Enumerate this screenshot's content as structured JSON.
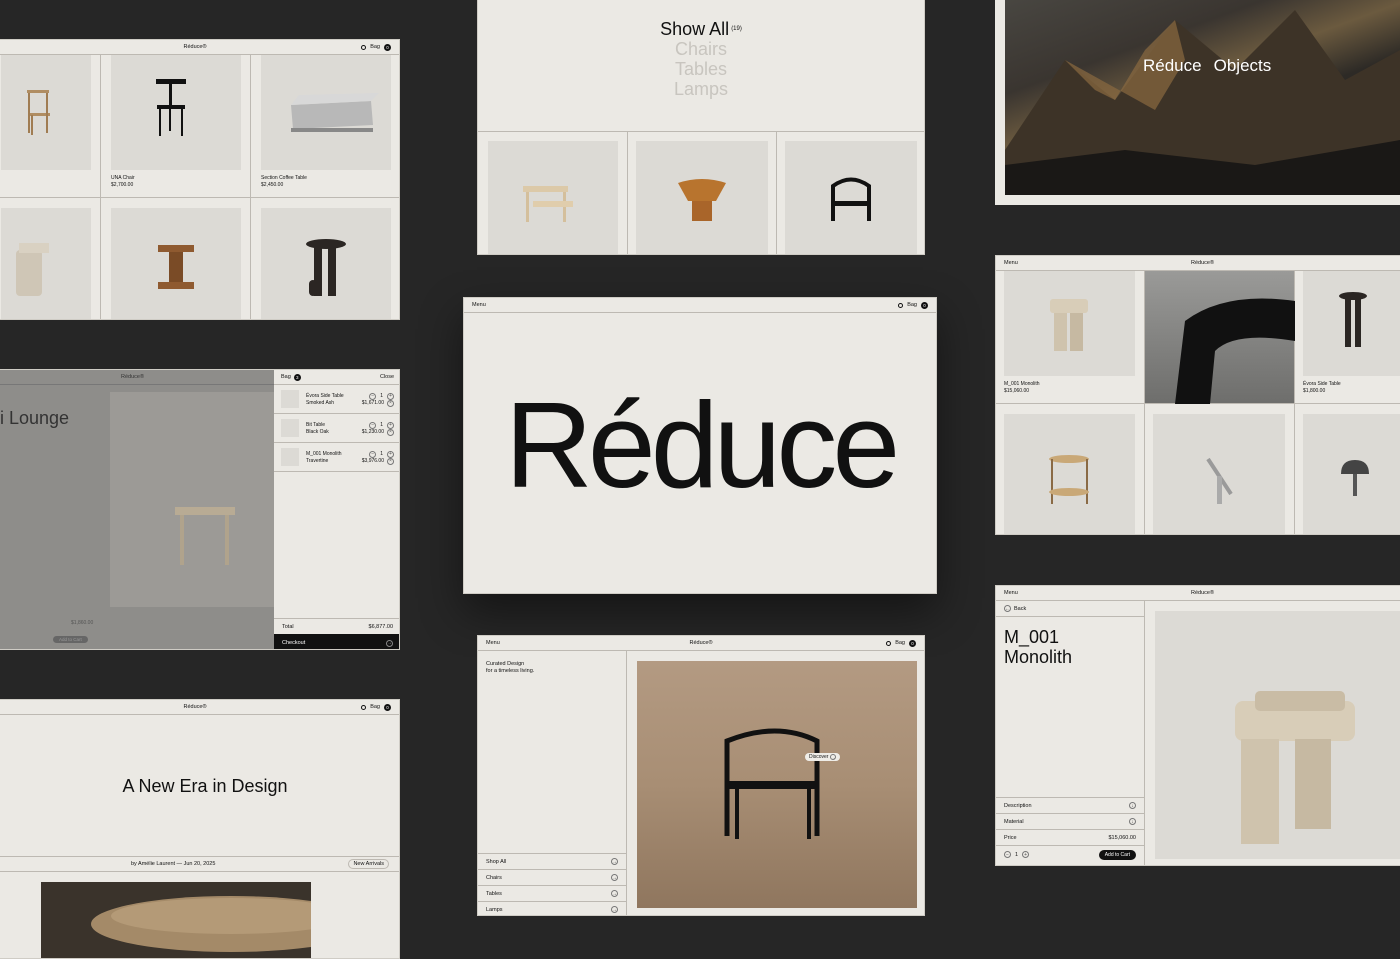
{
  "brand": "Réduce®",
  "common": {
    "menu": "Menu",
    "bag": "Bag",
    "bag_count": "0",
    "bag_count_filled": "3"
  },
  "grid_topleft": {
    "items": [
      {
        "name": "UNA Chair",
        "price": "$2,700.00"
      },
      {
        "name": "Section Coffee Table",
        "price": "$2,450.00"
      }
    ]
  },
  "show_all": {
    "title": "Show All",
    "count": "(19)",
    "filters": [
      "Chairs",
      "Tables",
      "Lamps"
    ]
  },
  "hero_mountain": {
    "links": [
      "Réduce",
      "Objects"
    ]
  },
  "bag_panel": {
    "bg_title": "ci Lounge\nr",
    "bag_label": "Bag",
    "close": "Close",
    "items": [
      {
        "name": "Évora Side Table",
        "variant": "Smoked Ash",
        "qty": "1",
        "price": "$1,671.00"
      },
      {
        "name": "Bit Table",
        "variant": "Black Oak",
        "qty": "1",
        "price": "$1,230.00"
      },
      {
        "name": "M_001 Monolith",
        "variant": "Travertine",
        "qty": "1",
        "price": "$3,976.00"
      }
    ],
    "total_label": "Total",
    "total": "$6,877.00",
    "checkout": "Checkout",
    "bg_price": "$1,860.00",
    "bg_add": "Add to Cart"
  },
  "center": {
    "wordmark": "Réduce"
  },
  "grid_right": {
    "items": [
      {
        "name": "M_001 Monolith",
        "price": "$15,060.00"
      },
      {
        "name": "Évora Side Table",
        "price": "$1,800.00"
      }
    ]
  },
  "article": {
    "title": "A New Era in Design",
    "byline": "by Amélie Laurent — Jun 20, 2025",
    "tag": "New Arrivals"
  },
  "curated": {
    "tagline": "Curated Design\nfor a timeless living.",
    "discover": "Discover",
    "nav": [
      "Shop All",
      "Chairs",
      "Tables",
      "Lamps"
    ]
  },
  "product": {
    "back": "Back",
    "title_line1": "M_001",
    "title_line2": "Monolith",
    "rows": [
      "Description",
      "Material"
    ],
    "price_label": "Price",
    "price": "$15,060.00",
    "qty": "1",
    "add": "Add to Cart"
  },
  "colors": {
    "bg": "#262626",
    "screen": "#ebe9e4",
    "ink": "#111111"
  }
}
